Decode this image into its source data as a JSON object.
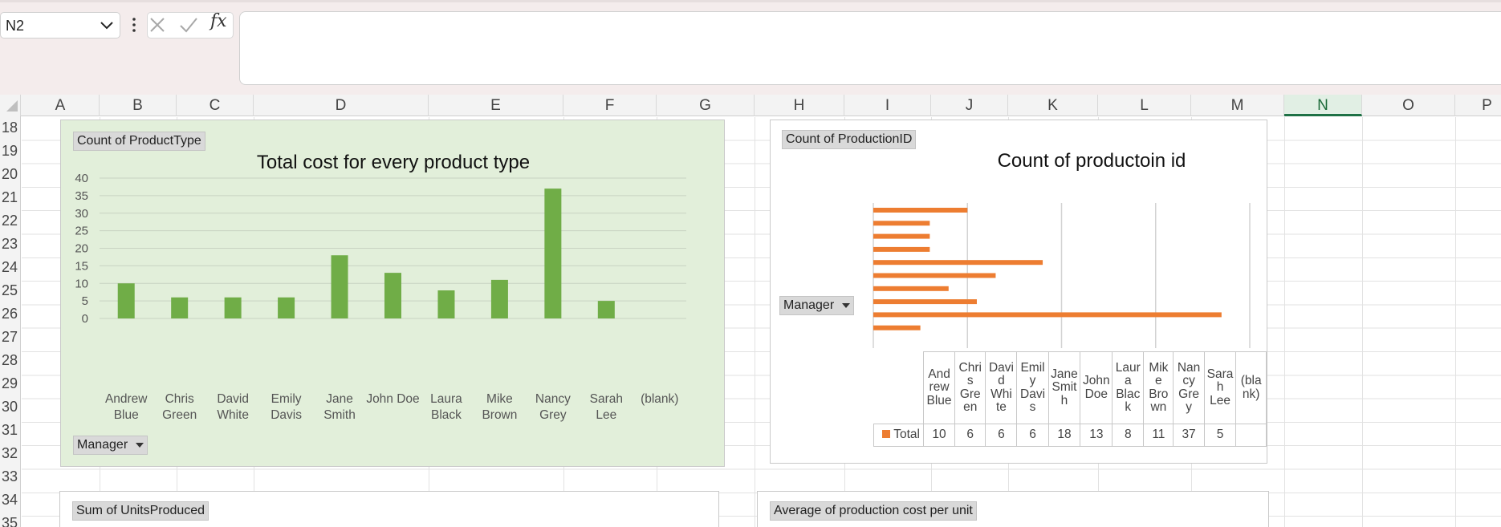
{
  "formula_bar": {
    "name_box": "N2",
    "fx_label": "fx",
    "formula": ""
  },
  "columns": [
    "A",
    "B",
    "C",
    "D",
    "E",
    "F",
    "G",
    "H",
    "I",
    "J",
    "K",
    "L",
    "M",
    "N",
    "O",
    "P"
  ],
  "selected_column": "N",
  "rows": [
    "18",
    "19",
    "20",
    "21",
    "22",
    "23",
    "24",
    "25",
    "26",
    "27",
    "28",
    "29",
    "30",
    "31",
    "32",
    "33",
    "34",
    "35"
  ],
  "chart1": {
    "field_button_values": "Count of ProductType",
    "field_button_axis": "Manager",
    "chart_data": {
      "type": "bar",
      "title": "Total cost for every product type",
      "categories": [
        "Andrew Blue",
        "Chris Green",
        "David White",
        "Emily Davis",
        "Jane Smith",
        "John Doe",
        "Laura Black",
        "Mike Brown",
        "Nancy Grey",
        "Sarah Lee",
        "(blank)"
      ],
      "category_lines": [
        [
          "Andrew",
          "Blue"
        ],
        [
          "Chris",
          "Green"
        ],
        [
          "David",
          "White"
        ],
        [
          "Emily",
          "Davis"
        ],
        [
          "Jane",
          "Smith"
        ],
        [
          "John Doe"
        ],
        [
          "Laura",
          "Black"
        ],
        [
          "Mike",
          "Brown"
        ],
        [
          "Nancy",
          "Grey"
        ],
        [
          "Sarah",
          "Lee"
        ],
        [
          "(blank)"
        ]
      ],
      "values": [
        10,
        6,
        6,
        6,
        18,
        13,
        8,
        11,
        37,
        5,
        null
      ],
      "ylim": [
        0,
        40
      ],
      "yticks": [
        "0",
        "5",
        "10",
        "15",
        "20",
        "25",
        "30",
        "35",
        "40"
      ],
      "grid": true,
      "color": "#70ad47"
    }
  },
  "chart2": {
    "field_button_values": "Count of ProductionID",
    "field_button_axis": "Manager",
    "chart_data": {
      "type": "bar",
      "title": "Count of productoin id",
      "orientation": "horizontal",
      "categories": [
        "Andrew Blue",
        "Chris Green",
        "David White",
        "Emily Davis",
        "Jane Smith",
        "John Doe",
        "Laura Black",
        "Mike Brown",
        "Nancy Grey",
        "Sarah Lee",
        "(blank)"
      ],
      "series": [
        {
          "name": "Total",
          "values": [
            10,
            6,
            6,
            6,
            18,
            13,
            8,
            11,
            37,
            5,
            null
          ]
        }
      ],
      "xlim": [
        0,
        40
      ],
      "color": "#ed7d31"
    },
    "table": {
      "legend_label": "Total",
      "headers": [
        [
          "And",
          "rew",
          "Blue"
        ],
        [
          "Chri",
          "s",
          "Gre",
          "en"
        ],
        [
          "Davi",
          "d",
          "Whi",
          "te"
        ],
        [
          "Emil",
          "y",
          "Davi",
          "s"
        ],
        [
          "Jane",
          "Smit",
          "h"
        ],
        [
          "John",
          "Doe"
        ],
        [
          "Laur",
          "a",
          "Blac",
          "k"
        ],
        [
          "Mik",
          "e",
          "Bro",
          "wn"
        ],
        [
          "Nan",
          "cy",
          "Gre",
          "y"
        ],
        [
          "Sara",
          "h",
          "Lee"
        ],
        [
          "(bla",
          "nk)"
        ]
      ],
      "values": [
        "10",
        "6",
        "6",
        "6",
        "18",
        "13",
        "8",
        "11",
        "37",
        "5",
        ""
      ]
    }
  },
  "chart3": {
    "field_button_values": "Sum of UnitsProduced"
  },
  "chart4": {
    "field_button_values": "Average of production cost per unit"
  }
}
